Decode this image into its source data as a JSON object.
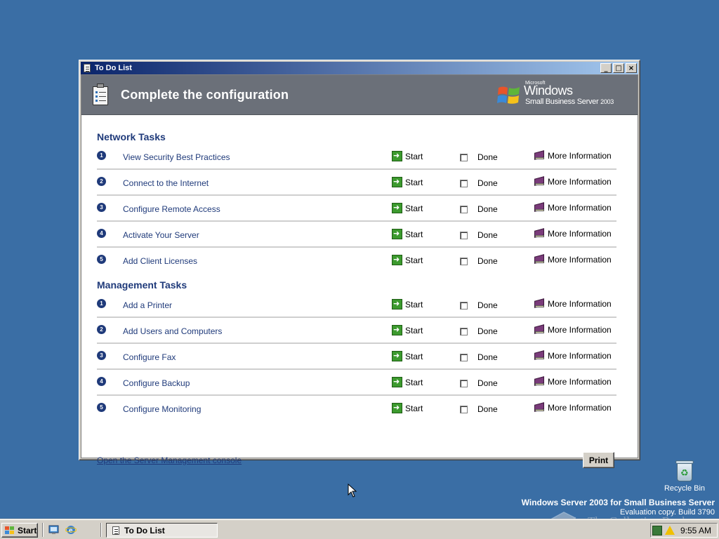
{
  "window": {
    "title": "To Do List",
    "minimize": "_",
    "maximize": "□",
    "close": "×"
  },
  "banner": {
    "title": "Complete the configuration",
    "brand_microsoft": "Microsoft",
    "brand_windows": "Windows",
    "brand_sub": "Small Business Server",
    "brand_year": "2003"
  },
  "labels": {
    "start": "Start",
    "done": "Done",
    "more": "More Information"
  },
  "network": {
    "heading": "Network Tasks",
    "tasks": [
      {
        "num": "1",
        "label": "View Security Best Practices"
      },
      {
        "num": "2",
        "label": "Connect to the Internet"
      },
      {
        "num": "3",
        "label": "Configure Remote Access"
      },
      {
        "num": "4",
        "label": "Activate Your Server"
      },
      {
        "num": "5",
        "label": "Add Client Licenses"
      }
    ]
  },
  "management": {
    "heading": "Management Tasks",
    "tasks": [
      {
        "num": "1",
        "label": "Add a Printer"
      },
      {
        "num": "2",
        "label": "Add Users and Computers"
      },
      {
        "num": "3",
        "label": "Configure Fax"
      },
      {
        "num": "4",
        "label": "Configure Backup"
      },
      {
        "num": "5",
        "label": "Configure Monitoring"
      }
    ]
  },
  "footer": {
    "link": "Open the Server Management console",
    "print": "Print"
  },
  "desktop": {
    "recycle_bin": "Recycle Bin",
    "server_name": "Windows Server 2003 for Small Business Server",
    "eval_text": "Evaluation copy. Build 3790",
    "watermark": "The Collection Book"
  },
  "taskbar": {
    "start": "Start",
    "task_button": "To Do List",
    "clock": "9:55 AM"
  },
  "colors": {
    "desktop": "#3a6ea5",
    "banner": "#6b7079",
    "link": "#1f3a7a",
    "title_gradient_start": "#0a246a"
  }
}
